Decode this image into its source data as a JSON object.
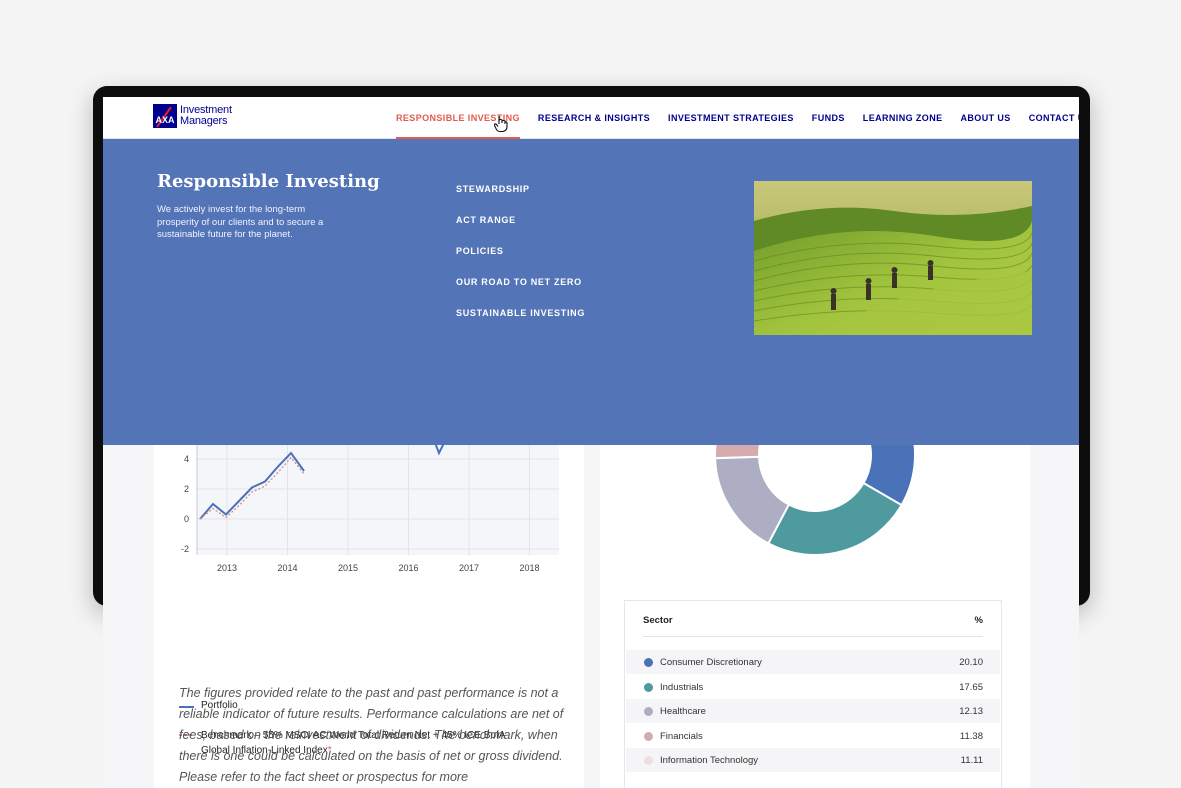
{
  "header": {
    "logo_line1": "Investment",
    "logo_line2": "Managers",
    "nav": [
      {
        "label": "RESPONSIBLE INVESTING"
      },
      {
        "label": "RESEARCH & INSIGHTS"
      },
      {
        "label": "INVESTMENT STRATEGIES"
      },
      {
        "label": "FUNDS"
      },
      {
        "label": "LEARNING ZONE"
      },
      {
        "label": "ABOUT US"
      },
      {
        "label": "CONTACT US"
      }
    ]
  },
  "mega": {
    "title": "Responsible Investing",
    "description": "We actively invest for the long-term prosperity of our clients and to secure a sustainable future for the planet.",
    "links": [
      "STEWARDSHIP",
      "ACT RANGE",
      "POLICIES",
      "OUR ROAD TO NET ZERO",
      "SUSTAINABLE INVESTING"
    ]
  },
  "chart_data": [
    {
      "type": "line",
      "x": [
        "2013",
        "2014",
        "2015",
        "2016",
        "2017",
        "2018"
      ],
      "yticks": [
        "4",
        "2",
        "0",
        "-2"
      ],
      "ylim": [
        -2,
        4
      ],
      "series": [
        {
          "name": "Portfolio",
          "color": "#4a72b8",
          "values": [
            0,
            1,
            0.3,
            1.2,
            2.1,
            2.5,
            3.5,
            4.4,
            3.2
          ]
        },
        {
          "name": "Benchmark – 55% MSCI AC World Total Return Net + 45% ICE BofA Global Inflation-Linked Index",
          "color": "#d28a8a",
          "values": [
            0,
            0.7,
            0.1,
            0.9,
            1.8,
            2.2,
            3.1,
            4.1,
            3.0
          ]
        }
      ]
    },
    {
      "type": "pie",
      "series": [
        {
          "name": "Consumer Discretionary",
          "value": 20.1,
          "color": "#4a72b8"
        },
        {
          "name": "Industrials",
          "value": 17.65,
          "color": "#4e9a9e"
        },
        {
          "name": "Healthcare",
          "value": 12.13,
          "color": "#adaec4"
        },
        {
          "name": "Financials",
          "value": 11.38,
          "color": "#d5abad"
        },
        {
          "name": "Information Technology",
          "value": 11.11,
          "color": "#f0dde0"
        }
      ]
    }
  ],
  "legend": {
    "portfolio": "Portfolio",
    "benchmark_line1": "Benchmark – 55% MSCI AC World Total Return Net + 45% ICE BofA",
    "benchmark_line2": "Global Inflation-Linked Index",
    "asterisk": "*"
  },
  "disclaimer": "The figures provided relate to the past and past performance is not a reliable indicator of future results. Performance calculations are net of fees, based on the reinvestment of dividends. The benchmark, when there is one could be calculated on the basis of net or gross dividend. Please refer to the fact sheet or prospectus for more",
  "sector_table": {
    "col_sector": "Sector",
    "col_pct": "%",
    "rows": [
      {
        "name": "Consumer Discretionary",
        "value": "20.10",
        "color": "#4a72b8"
      },
      {
        "name": "Industrials",
        "value": "17.65",
        "color": "#4e9a9e"
      },
      {
        "name": "Healthcare",
        "value": "12.13",
        "color": "#adaec4"
      },
      {
        "name": "Financials",
        "value": "11.38",
        "color": "#d5abad"
      },
      {
        "name": "Information Technology",
        "value": "11.11",
        "color": "#f0dde0"
      }
    ]
  }
}
